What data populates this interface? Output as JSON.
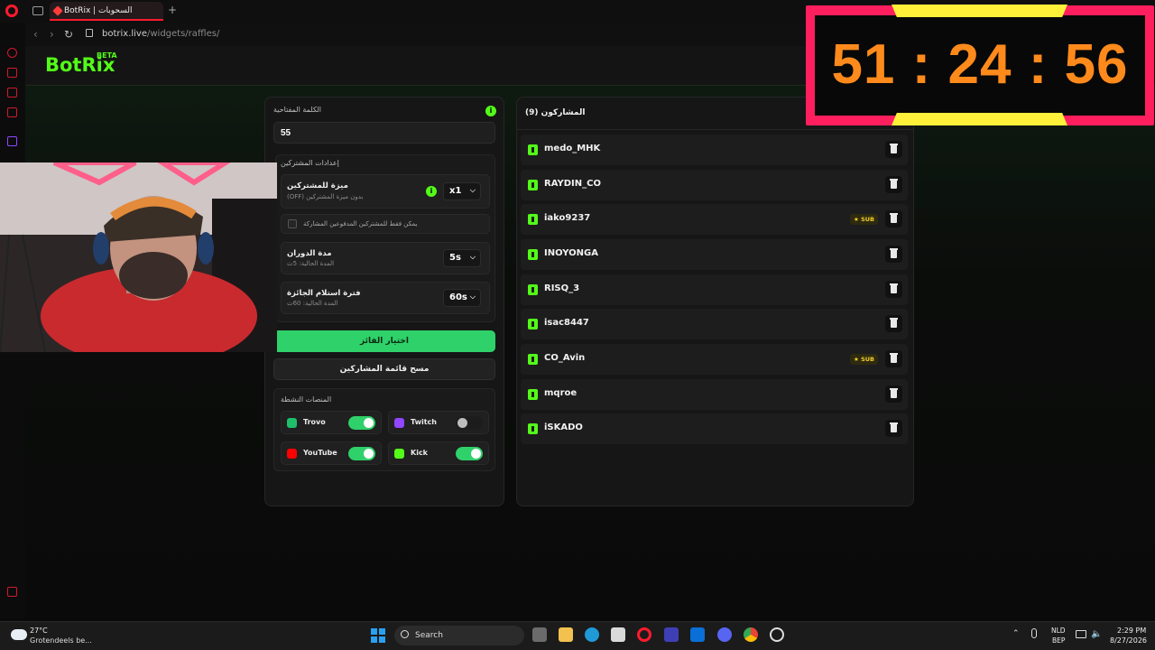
{
  "browser": {
    "tab_title": "BotRix | السحوبات",
    "new_tab": "+",
    "url_host": "botrix.live",
    "url_path": "/widgets/raffles/"
  },
  "site": {
    "logo": "BotRix",
    "logo_badge": "BETA"
  },
  "settings": {
    "keyword_label": "الكلمة المفتاحية",
    "keyword_value": "55",
    "participant_settings_title": "إعدادات المشتركين",
    "sub_bonus_label": "ميزة للمشتركين",
    "sub_bonus_sub": "بدون ميزة المشتركين (OFF)",
    "sub_bonus_value": "x1",
    "followers_only_label": "يمكن فقط للمشتركين المدفوعين المشاركة",
    "spin_label": "مدة الدوران",
    "spin_sub": "المدة الحالية: 5ث",
    "spin_value": "5s",
    "claim_label": "فترة استلام الجائزة",
    "claim_sub": "المدة الحالية: 60ث",
    "claim_value": "60s",
    "pick_winner": "اختيار الفائز",
    "clear_list": "مسح قائمة المشاركين",
    "platforms_title": "المنصات النشطة",
    "platforms": [
      {
        "name": "Trovo",
        "enabled": true,
        "color": "#1fbf6a"
      },
      {
        "name": "Twitch",
        "enabled": false,
        "color": "#9146ff"
      },
      {
        "name": "YouTube",
        "enabled": true,
        "color": "#ff0000"
      },
      {
        "name": "Kick",
        "enabled": true,
        "color": "#53fc18"
      }
    ]
  },
  "participants": {
    "title": "المشاركون (9)",
    "sub_badge": "SUB",
    "list": [
      {
        "name": "medo_MHK",
        "sub": false
      },
      {
        "name": "RAYDIN_CO",
        "sub": false
      },
      {
        "name": "iako9237",
        "sub": true
      },
      {
        "name": "INOYONGA",
        "sub": false
      },
      {
        "name": "RISQ_3",
        "sub": false
      },
      {
        "name": "isac8447",
        "sub": false
      },
      {
        "name": "CO_Avin",
        "sub": true
      },
      {
        "name": "mqroe",
        "sub": false
      },
      {
        "name": "iSKADO",
        "sub": false
      }
    ]
  },
  "timer": {
    "display": "51 : 24 : 56"
  },
  "taskbar": {
    "weather_temp": "27°C",
    "weather_desc": "Grotendeels be...",
    "search": "Search",
    "lang_top": "NLD",
    "lang_bottom": "BEP",
    "time": "2:29 PM",
    "date": "8/27/2026"
  },
  "colors": {
    "accent": "#53fc18",
    "button_green": "#2fd16a",
    "opera_red": "#ff1b2d",
    "timer_frame": "#ff1f5e",
    "timer_digits": "#ff8a1c"
  }
}
